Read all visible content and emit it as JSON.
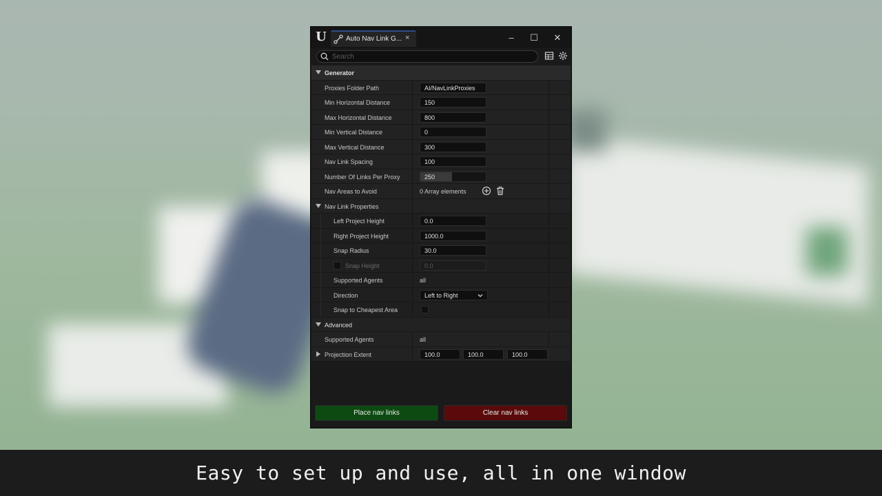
{
  "window": {
    "tab_title": "Auto Nav Link G...",
    "tab_close": "×",
    "controls": {
      "minimize": "–",
      "maximize": "☐",
      "close": "✕"
    }
  },
  "search": {
    "placeholder": "Search"
  },
  "icons": {
    "logo": "unreal-engine-logo",
    "tab": "nav-link-icon",
    "search": "search-icon",
    "table": "table-view-icon",
    "settings": "gear-icon",
    "add": "add-element-icon",
    "trash": "trash-icon",
    "chevron": "chevron-down-icon"
  },
  "generator": {
    "label": "Generator",
    "rows": [
      {
        "label": "Proxies Folder Path",
        "value": "AI/NavLinkProxies"
      },
      {
        "label": "Min Horizontal Distance",
        "value": "150"
      },
      {
        "label": "Max Horizontal Distance",
        "value": "800"
      },
      {
        "label": "Min Vertical Distance",
        "value": "0"
      },
      {
        "label": "Max Vertical Distance",
        "value": "300"
      },
      {
        "label": "Nav Link Spacing",
        "value": "100"
      },
      {
        "label": "Number Of Links Per Proxy",
        "value": "250",
        "slider_fraction": 0.48
      },
      {
        "label": "Nav Areas to Avoid",
        "value": "0 Array elements"
      }
    ]
  },
  "nav_link_properties": {
    "label": "Nav Link Properties",
    "rows": [
      {
        "label": "Left Project Height",
        "value": "0.0"
      },
      {
        "label": "Right Project Height",
        "value": "1000.0"
      },
      {
        "label": "Snap Radius",
        "value": "30.0"
      },
      {
        "label": "Snap Height",
        "value": "0.0",
        "enabled": false
      },
      {
        "label": "Supported Agents",
        "value": "all"
      },
      {
        "label": "Direction",
        "value": "Left to Right"
      },
      {
        "label": "Snap to Cheapest Area",
        "checked": false
      }
    ]
  },
  "advanced": {
    "label": "Advanced",
    "rows": [
      {
        "label": "Supported Agents",
        "value": "all"
      },
      {
        "label": "Projection Extent",
        "values": [
          "100.0",
          "100.0",
          "100.0"
        ]
      }
    ]
  },
  "buttons": {
    "place": "Place nav links",
    "clear": "Clear nav links",
    "place_color": "#0d4a12",
    "clear_color": "#5a0a0a"
  },
  "caption": "Easy to set up and use, all in one window"
}
